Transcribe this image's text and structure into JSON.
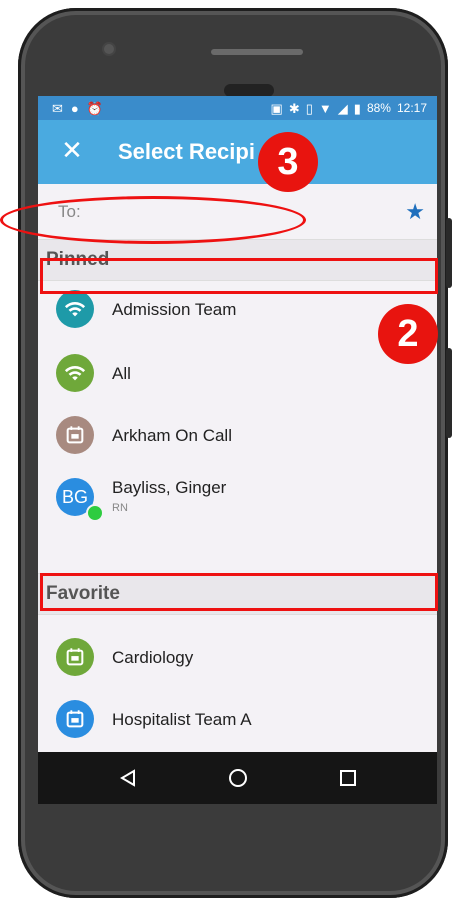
{
  "status_bar": {
    "battery": "88%",
    "time": "12:17"
  },
  "app_bar": {
    "close_icon": "close-icon",
    "title": "Select Recipi"
  },
  "to_field": {
    "label": "To:",
    "star_icon": "star-icon"
  },
  "sections": {
    "pinned": {
      "label": "Pinned",
      "items": [
        {
          "name": "Admission Team",
          "icon": "wifi-icon",
          "color": "#1e9aa8"
        },
        {
          "name": "All",
          "icon": "wifi-icon",
          "color": "#6fa83a"
        },
        {
          "name": "Arkham On Call",
          "icon": "calendar-icon",
          "color": "#a88a80"
        },
        {
          "name": "Bayliss, Ginger",
          "subtitle": "RN",
          "initials": "BG",
          "color": "#2a8de0"
        }
      ]
    },
    "favorite": {
      "label": "Favorite",
      "items": [
        {
          "name": "Cardiology",
          "icon": "calendar-icon",
          "color": "#6fa83a"
        },
        {
          "name": "Hospitalist Team A",
          "icon": "calendar-icon",
          "color": "#2a8de0"
        }
      ]
    }
  },
  "annotations": {
    "badge_2": "2",
    "badge_3": "3"
  },
  "colors": {
    "accent": "#4aaae0",
    "annotation": "#e8140f"
  }
}
